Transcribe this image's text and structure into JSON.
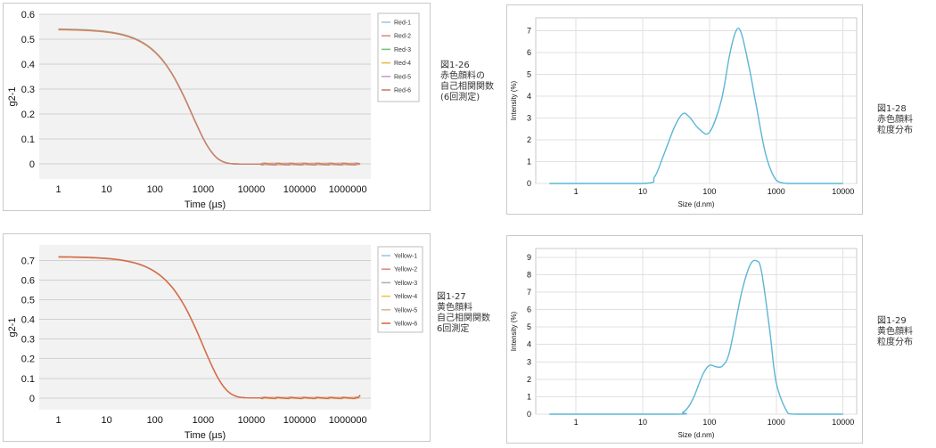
{
  "captions": {
    "fig26": [
      "図1-26",
      "赤色顔料の",
      "自己相関関数",
      "(6回測定)"
    ],
    "fig27": [
      "図1-27",
      "黄色顔料",
      "自己相関関数",
      "6回測定"
    ],
    "fig28": [
      "図1-28",
      "赤色顔料",
      "粒度分布"
    ],
    "fig29": [
      "図1-29",
      "黄色顔料",
      "粒度分布"
    ]
  },
  "chart_data": [
    {
      "id": "red_correlation",
      "type": "line",
      "title": "",
      "xlabel": "Time (µs)",
      "ylabel": "g2-1",
      "xscale": "log",
      "xlim": [
        0.4,
        3000000
      ],
      "ylim": [
        -0.06,
        0.6
      ],
      "x_ticks": [
        1,
        10,
        100,
        1000,
        10000,
        100000,
        1000000
      ],
      "x_tick_labels": [
        "1",
        "10",
        "100",
        "1000",
        "10000",
        "100000",
        "1000000"
      ],
      "y_ticks": [
        0,
        0.1,
        0.2,
        0.3,
        0.4,
        0.5,
        0.6
      ],
      "y_tick_labels": [
        "0",
        "0.1",
        "0.2",
        "0.3",
        "0.4",
        "0.5",
        "0.6"
      ],
      "grid": true,
      "legend_position": "right",
      "curve": {
        "amplitude": 0.54,
        "tau_us": 500,
        "beta": 1.5
      },
      "x": [
        1,
        10,
        30,
        100,
        200,
        300,
        500,
        1000,
        2000,
        5000,
        10000,
        100000,
        1000000,
        1800000
      ],
      "series": [
        {
          "name": "Red-1",
          "color": "#9cc8e8",
          "values": [
            0.541,
            0.536,
            0.525,
            0.462,
            0.383,
            0.322,
            0.218,
            0.065,
            0.016,
            0.001,
            0.0,
            0.0,
            0.0,
            0.0
          ]
        },
        {
          "name": "Red-2",
          "color": "#e08b86",
          "values": [
            0.54,
            0.535,
            0.524,
            0.461,
            0.382,
            0.321,
            0.217,
            0.064,
            0.015,
            0.001,
            0.0,
            0.0,
            0.0,
            0.0
          ]
        },
        {
          "name": "Red-3",
          "color": "#7fbf7f",
          "values": [
            0.542,
            0.537,
            0.526,
            0.463,
            0.384,
            0.323,
            0.219,
            0.066,
            0.016,
            0.001,
            0.0,
            0.0,
            0.0,
            0.0
          ]
        },
        {
          "name": "Red-4",
          "color": "#f0b64a",
          "values": [
            0.539,
            0.534,
            0.523,
            0.46,
            0.381,
            0.32,
            0.216,
            0.064,
            0.015,
            0.001,
            0.0,
            0.0,
            0.0,
            0.0
          ]
        },
        {
          "name": "Red-5",
          "color": "#c9a0c9",
          "values": [
            0.541,
            0.536,
            0.525,
            0.462,
            0.383,
            0.322,
            0.218,
            0.065,
            0.016,
            0.001,
            0.0,
            0.0,
            0.0,
            0.0
          ]
        },
        {
          "name": "Red-6",
          "color": "#c9806a",
          "values": [
            0.54,
            0.535,
            0.524,
            0.461,
            0.382,
            0.321,
            0.217,
            0.065,
            0.015,
            0.001,
            0.0,
            0.0,
            0.0,
            0.0
          ]
        }
      ]
    },
    {
      "id": "yellow_correlation",
      "type": "line",
      "title": "",
      "xlabel": "Time (µs)",
      "ylabel": "g2-1",
      "xscale": "log",
      "xlim": [
        0.4,
        3000000
      ],
      "ylim": [
        -0.06,
        0.78
      ],
      "x_ticks": [
        1,
        10,
        100,
        1000,
        10000,
        100000,
        1000000
      ],
      "x_tick_labels": [
        "1",
        "10",
        "100",
        "1000",
        "10000",
        "100000",
        "1000000"
      ],
      "y_ticks": [
        0,
        0.1,
        0.2,
        0.3,
        0.4,
        0.5,
        0.6,
        0.7
      ],
      "y_tick_labels": [
        "0",
        "0.1",
        "0.2",
        "0.3",
        "0.4",
        "0.5",
        "0.6",
        "0.7"
      ],
      "grid": true,
      "legend_position": "right",
      "curve": {
        "amplitude": 0.72,
        "tau_us": 850,
        "beta": 1.45
      },
      "x": [
        1,
        10,
        30,
        100,
        300,
        500,
        1000,
        2000,
        5000,
        10000,
        100000,
        1000000,
        1800000
      ],
      "series": [
        {
          "name": "Yellow-1",
          "color": "#9cc8e8",
          "values": [
            0.72,
            0.714,
            0.704,
            0.66,
            0.545,
            0.452,
            0.262,
            0.07,
            0.006,
            0.0,
            0.0,
            0.0,
            0.01
          ]
        },
        {
          "name": "Yellow-2",
          "color": "#e08b86",
          "values": [
            0.719,
            0.713,
            0.703,
            0.659,
            0.544,
            0.451,
            0.261,
            0.069,
            0.006,
            0.0,
            0.0,
            0.0,
            0.01
          ]
        },
        {
          "name": "Yellow-3",
          "color": "#b0b0b0",
          "values": [
            0.721,
            0.715,
            0.705,
            0.661,
            0.546,
            0.453,
            0.263,
            0.071,
            0.006,
            0.0,
            0.0,
            0.0,
            0.01
          ]
        },
        {
          "name": "Yellow-4",
          "color": "#f0c64a",
          "values": [
            0.72,
            0.714,
            0.704,
            0.66,
            0.545,
            0.452,
            0.262,
            0.07,
            0.006,
            0.0,
            0.0,
            0.0,
            0.01
          ]
        },
        {
          "name": "Yellow-5",
          "color": "#d9b99a",
          "values": [
            0.719,
            0.713,
            0.703,
            0.659,
            0.544,
            0.451,
            0.261,
            0.069,
            0.006,
            0.0,
            0.0,
            0.0,
            0.01
          ]
        },
        {
          "name": "Yellow-6",
          "color": "#d9694a",
          "values": [
            0.72,
            0.714,
            0.704,
            0.66,
            0.545,
            0.452,
            0.262,
            0.07,
            0.006,
            0.0,
            0.0,
            0.0,
            0.015
          ]
        }
      ]
    },
    {
      "id": "red_size_distribution",
      "type": "line",
      "title": "",
      "xlabel": "Size (d.nm)",
      "ylabel": "Intensity (%)",
      "xscale": "log",
      "xlim": [
        0.25,
        16000
      ],
      "ylim": [
        0,
        7.6
      ],
      "x_ticks": [
        1,
        10,
        100,
        1000,
        10000
      ],
      "x_tick_labels": [
        "1",
        "10",
        "100",
        "1000",
        "10000"
      ],
      "y_ticks": [
        0,
        1,
        2,
        3,
        4,
        5,
        6,
        7
      ],
      "y_tick_labels": [
        "0",
        "1",
        "2",
        "3",
        "4",
        "5",
        "6",
        "7"
      ],
      "grid": true,
      "series": [
        {
          "name": "",
          "color": "#5bb6d6",
          "x": [
            0.4,
            10,
            15,
            20,
            30,
            40,
            50,
            70,
            100,
            150,
            200,
            250,
            300,
            400,
            500,
            700,
            1000,
            1500,
            2000,
            10000
          ],
          "values": [
            0,
            0,
            0.3,
            1.2,
            2.6,
            3.2,
            3.05,
            2.5,
            2.35,
            3.8,
            5.9,
            7.0,
            6.9,
            5.2,
            3.6,
            1.3,
            0.15,
            0,
            0,
            0
          ]
        }
      ]
    },
    {
      "id": "yellow_size_distribution",
      "type": "line",
      "title": "",
      "xlabel": "Size (d.nm)",
      "ylabel": "Intensity (%)",
      "xscale": "log",
      "xlim": [
        0.25,
        16000
      ],
      "ylim": [
        0,
        9.5
      ],
      "x_ticks": [
        1,
        10,
        100,
        1000,
        10000
      ],
      "x_tick_labels": [
        "1",
        "10",
        "100",
        "1000",
        "10000"
      ],
      "y_ticks": [
        0,
        1,
        2,
        3,
        4,
        5,
        6,
        7,
        8,
        9
      ],
      "y_tick_labels": [
        "0",
        "1",
        "2",
        "3",
        "4",
        "5",
        "6",
        "7",
        "8",
        "9"
      ],
      "grid": true,
      "series": [
        {
          "name": "",
          "color": "#5bb6d6",
          "x": [
            0.4,
            30,
            40,
            50,
            60,
            80,
            100,
            130,
            160,
            200,
            300,
            400,
            500,
            600,
            800,
            1000,
            1500,
            2000,
            10000
          ],
          "values": [
            0,
            0,
            0.1,
            0.5,
            1.1,
            2.3,
            2.8,
            2.7,
            2.8,
            3.6,
            6.9,
            8.5,
            8.8,
            8.2,
            4.8,
            1.8,
            0.05,
            0,
            0
          ]
        }
      ]
    }
  ]
}
